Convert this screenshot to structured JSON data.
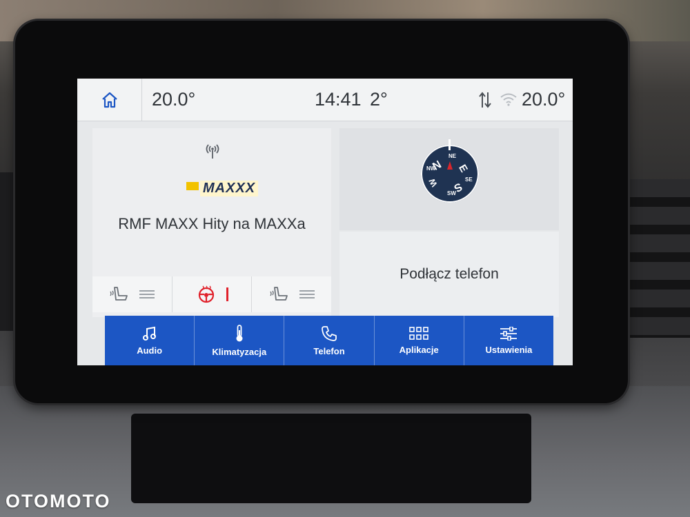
{
  "status_bar": {
    "temp_left": "20.0°",
    "time": "14:41",
    "outside_temp": "2°",
    "temp_right": "20.0°"
  },
  "radio": {
    "station_logo": "MAXXX",
    "station_name": "RMF MAXX Hity na MAXXa"
  },
  "phone": {
    "prompt": "Podłącz telefon"
  },
  "compass": {
    "labels": {
      "n": "N",
      "ne": "NE",
      "e": "E",
      "se": "SE",
      "s": "S",
      "sw": "SW",
      "w": "W",
      "nw": "NW"
    }
  },
  "nav": [
    {
      "label": "Audio",
      "icon": "music-note-icon"
    },
    {
      "label": "Klimatyzacja",
      "icon": "thermometer-icon"
    },
    {
      "label": "Telefon",
      "icon": "phone-icon"
    },
    {
      "label": "Aplikacje",
      "icon": "apps-grid-icon"
    },
    {
      "label": "Ustawienia",
      "icon": "sliders-icon"
    }
  ],
  "watermark": "OTOMOTO",
  "colors": {
    "nav_blue": "#1c56c4",
    "accent_red": "#e0202a",
    "compass_navy": "#1f3352"
  }
}
